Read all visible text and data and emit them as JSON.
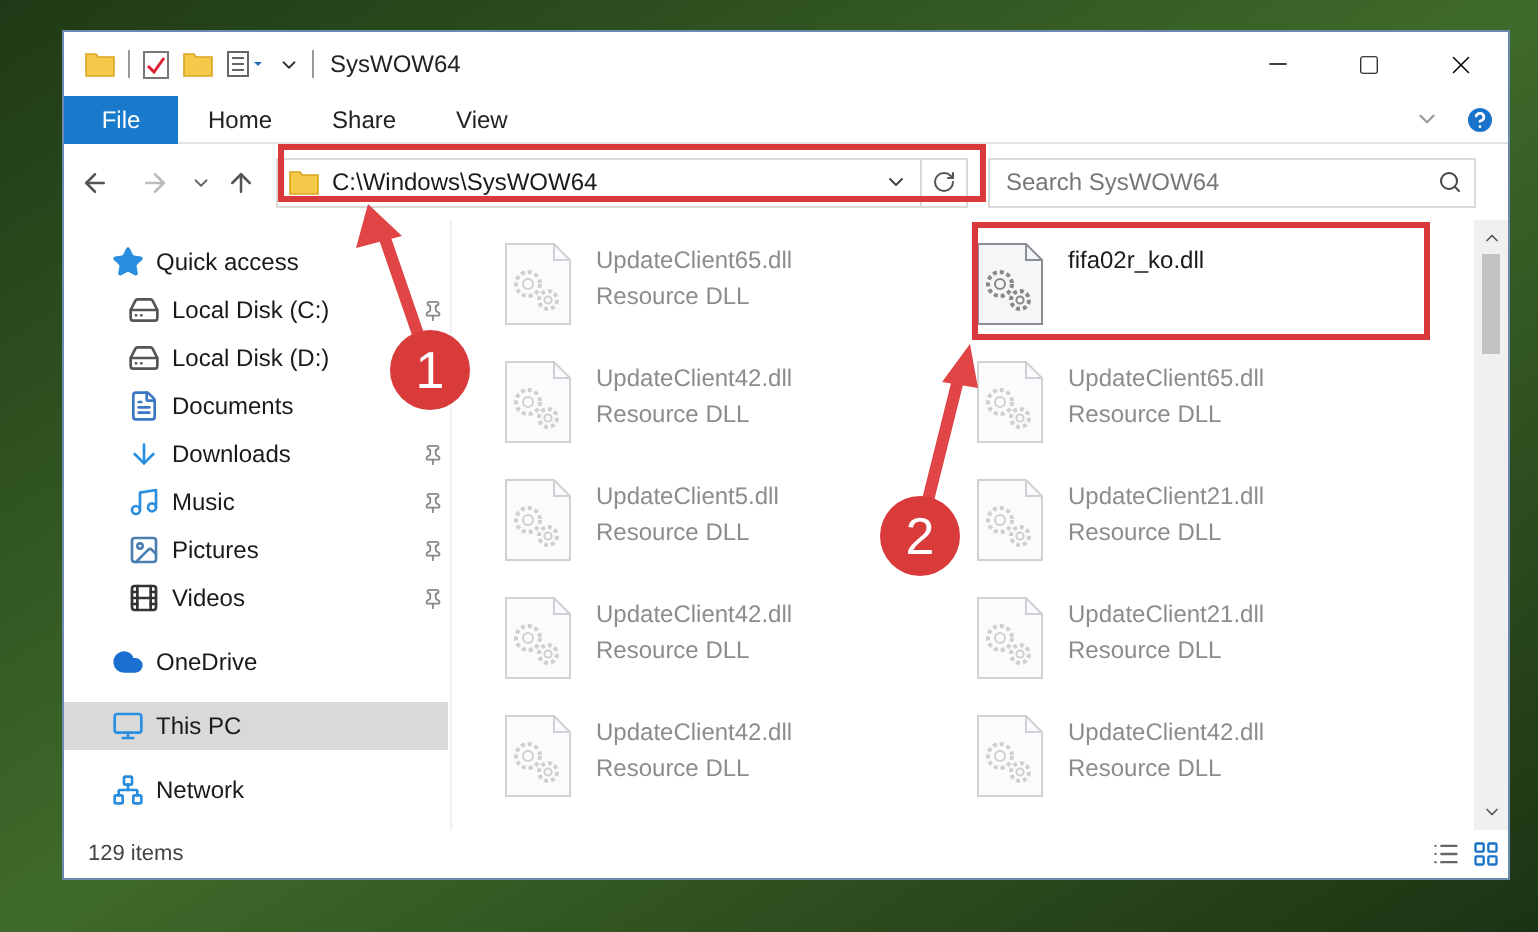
{
  "window": {
    "title": "SysWOW64"
  },
  "ribbon_tabs": [
    {
      "label": "File",
      "kind": "file",
      "selected": false
    },
    {
      "label": "Home",
      "kind": "tab",
      "selected": false
    },
    {
      "label": "Share",
      "kind": "tab",
      "selected": false
    },
    {
      "label": "View",
      "kind": "tab",
      "selected": false
    }
  ],
  "address_bar": {
    "path": "C:\\Windows\\SysWOW64"
  },
  "search": {
    "placeholder": "Search SysWOW64"
  },
  "sidebar": {
    "items": [
      {
        "label": "Quick access",
        "kind": "star",
        "selected": false,
        "children": [
          {
            "label": "Local Disk (C:)",
            "kind": "system-disk",
            "pinned": true,
            "selected": false
          },
          {
            "label": "Local Disk (D:)",
            "kind": "disk",
            "pinned": false,
            "selected": false
          },
          {
            "label": "Documents",
            "kind": "documents",
            "pinned": false,
            "selected": false
          },
          {
            "label": "Downloads",
            "kind": "downloads",
            "pinned": true,
            "selected": false
          },
          {
            "label": "Music",
            "kind": "music",
            "pinned": true,
            "selected": false
          },
          {
            "label": "Pictures",
            "kind": "pictures",
            "pinned": true,
            "selected": false
          },
          {
            "label": "Videos",
            "kind": "videos",
            "pinned": true,
            "selected": false
          }
        ]
      },
      {
        "label": "OneDrive",
        "kind": "cloud",
        "selected": false
      },
      {
        "label": "This PC",
        "kind": "pc",
        "selected": true
      },
      {
        "label": "Network",
        "kind": "network",
        "selected": false
      }
    ]
  },
  "files": [
    {
      "name": "UpdateClient65.dll",
      "type": "Resource DLL",
      "faded": true
    },
    {
      "name": "fifa02r_ko.dll",
      "faded": false
    },
    {
      "name": "UpdateClient42.dll",
      "type": "Resource DLL",
      "faded": true
    },
    {
      "name": "UpdateClient65.dll",
      "type": "Resource DLL",
      "faded": true
    },
    {
      "name": "UpdateClient5.dll",
      "type": "Resource DLL",
      "faded": true
    },
    {
      "name": "UpdateClient21.dll",
      "type": "Resource DLL",
      "faded": true
    },
    {
      "name": "UpdateClient42.dll",
      "type": "Resource DLL",
      "faded": true
    },
    {
      "name": "UpdateClient21.dll",
      "type": "Resource DLL",
      "faded": true
    },
    {
      "name": "UpdateClient42.dll",
      "type": "Resource DLL",
      "faded": true
    },
    {
      "name": "UpdateClient42.dll",
      "type": "Resource DLL",
      "faded": true
    }
  ],
  "status_bar": {
    "item_count": "129 items"
  },
  "annotations": [
    {
      "number": "1"
    },
    {
      "number": "2"
    }
  ]
}
